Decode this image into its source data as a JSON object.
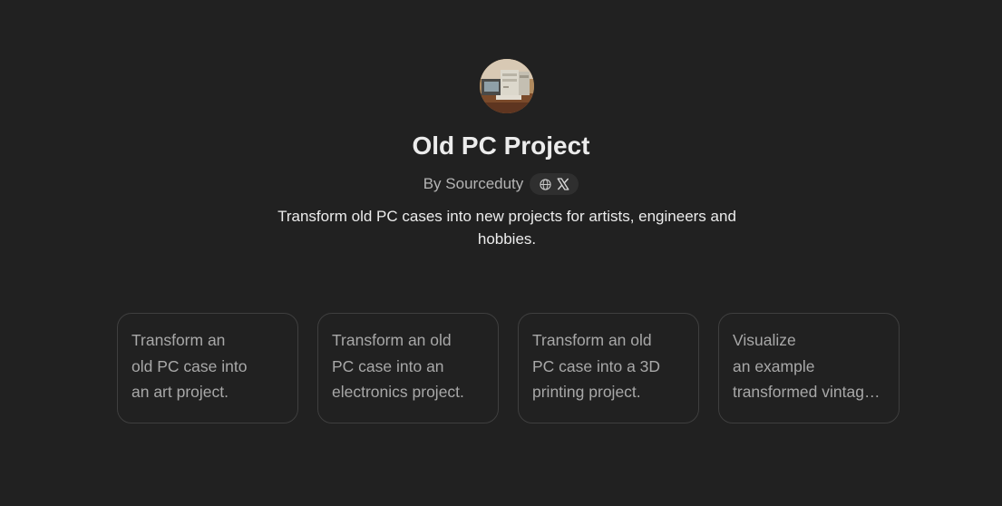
{
  "gpt": {
    "title": "Old PC Project",
    "byline": "By Sourceduty",
    "description": "Transform old PC cases into new projects for artists, engineers and hobbies.",
    "social_icons": [
      "globe-icon",
      "x-logo-icon"
    ]
  },
  "starters": [
    {
      "text": "Transform an\nold PC case into\nan art project."
    },
    {
      "text": "Transform an old\nPC case into an\nelectronics project."
    },
    {
      "text": "Transform an old\nPC case into a 3D\nprinting project."
    },
    {
      "text": "Visualize\nan example\ntransformed vintage PC case."
    }
  ],
  "colors": {
    "background": "#212121",
    "card_border": "#3f3f3f",
    "text_primary": "#ececec",
    "text_secondary": "#b4b4b4"
  }
}
